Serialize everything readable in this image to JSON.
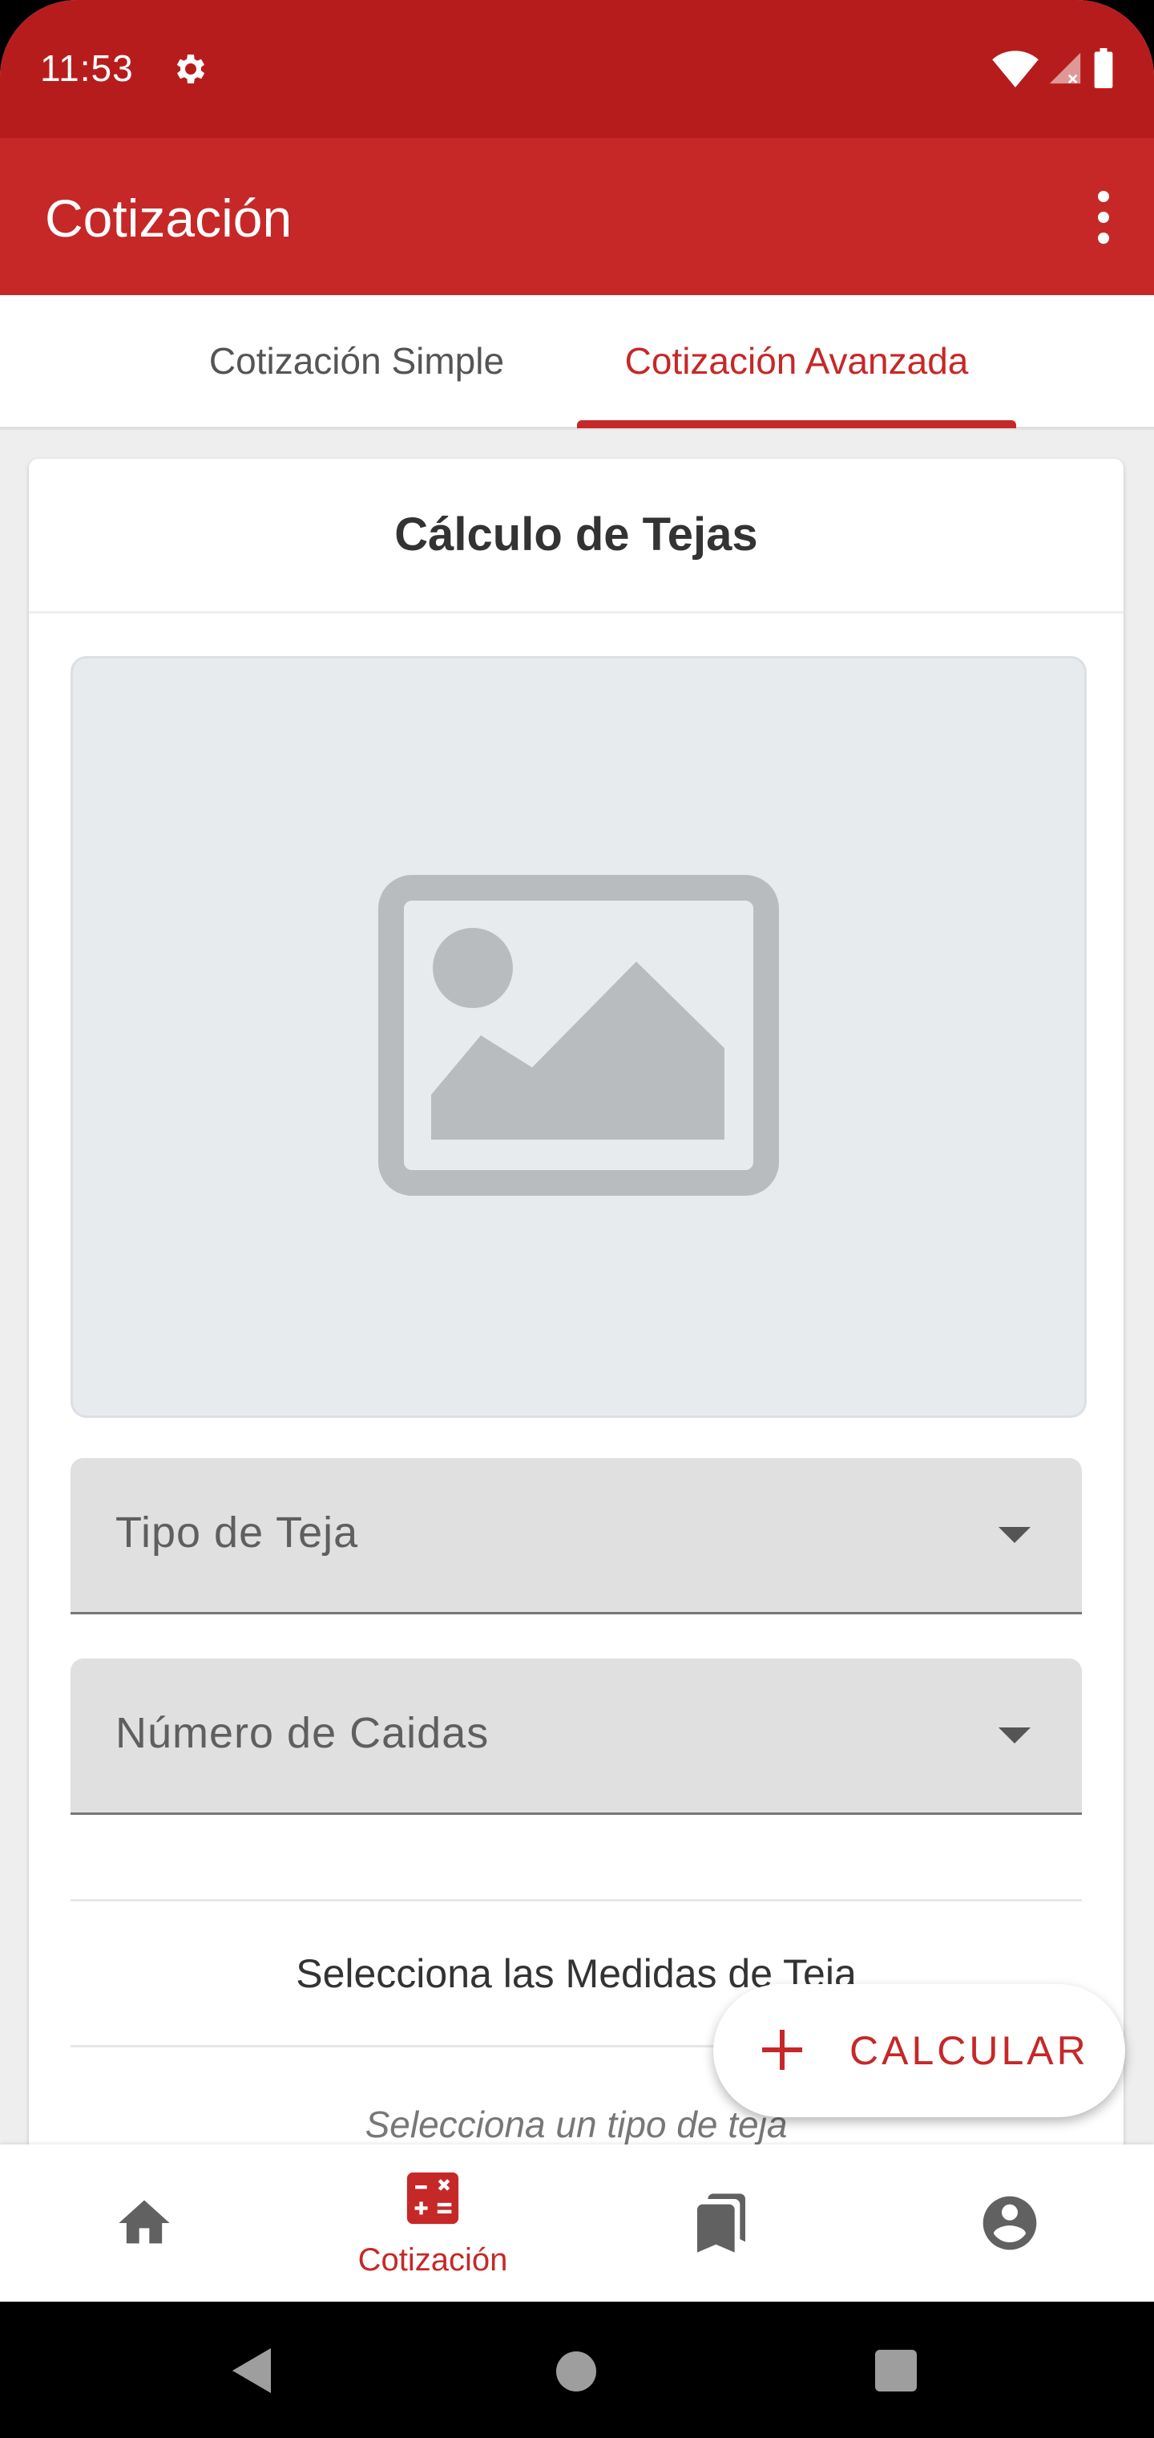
{
  "status_bar": {
    "time": "11:53",
    "left_icons": [
      "settings-gear-icon"
    ],
    "right_icons": [
      "wifi-icon",
      "signal-no-service-icon",
      "battery-icon"
    ]
  },
  "app_bar": {
    "title": "Cotización",
    "menu_icon": "more-vert-icon"
  },
  "tabs": [
    {
      "label": "Cotización Simple",
      "selected": false
    },
    {
      "label": "Cotización Avanzada",
      "selected": true
    }
  ],
  "card": {
    "title": "Cálculo de Tejas",
    "image_placeholder_icon": "image-placeholder-icon",
    "fields": [
      {
        "label": "Tipo de Teja",
        "value": ""
      },
      {
        "label": "Número de Caidas",
        "value": ""
      }
    ],
    "section_label": "Selecciona las Medidas de Teja",
    "hint": "Selecciona un tipo de teja"
  },
  "fab": {
    "label": "CALCULAR",
    "icon": "plus-icon"
  },
  "bottom_nav": {
    "items": [
      {
        "icon": "home-icon",
        "label": "",
        "selected": false
      },
      {
        "icon": "calculator-icon",
        "label": "Cotización",
        "selected": true
      },
      {
        "icon": "bookmarks-icon",
        "label": "",
        "selected": false
      },
      {
        "icon": "account-circle-icon",
        "label": "",
        "selected": false
      }
    ]
  },
  "colors": {
    "primary": "#c62828",
    "primary_dark": "#b71c1c",
    "icon_gray": "#616161"
  }
}
